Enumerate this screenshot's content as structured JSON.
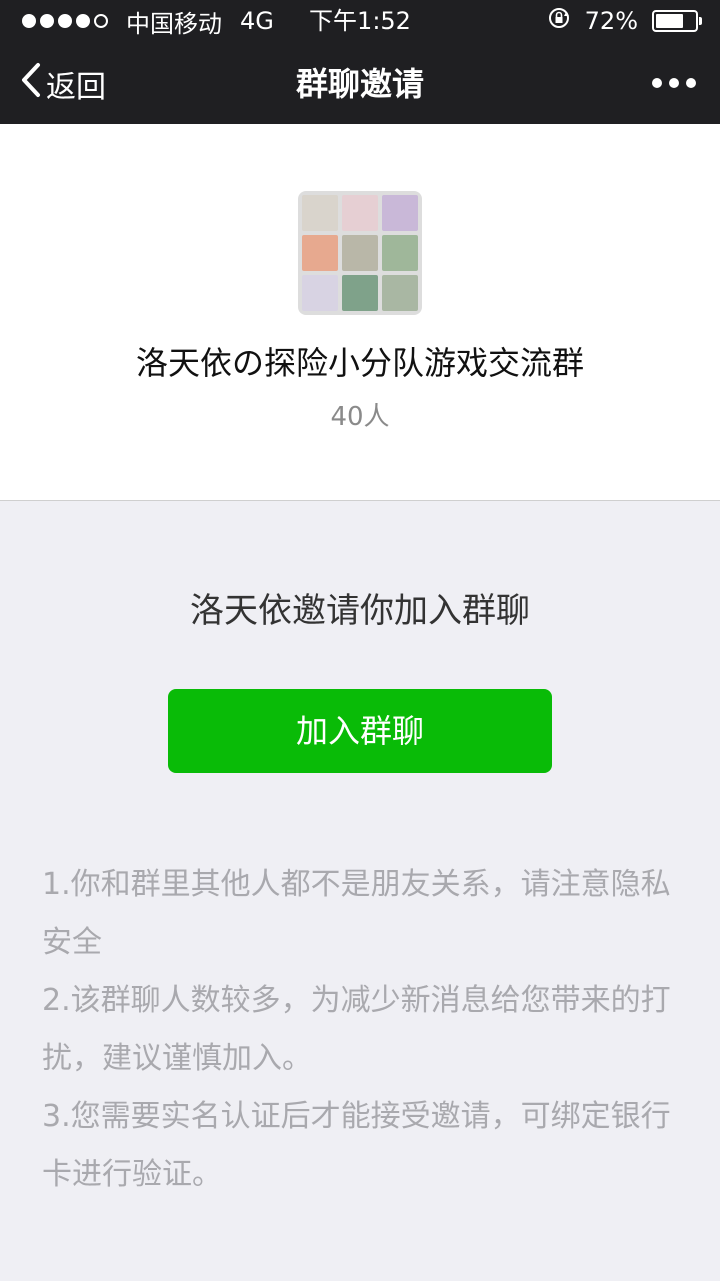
{
  "status_bar": {
    "carrier": "中国移动",
    "network": "4G",
    "time": "下午1:52",
    "battery_percent_text": "72%",
    "battery_level": 0.72,
    "signal_bars_filled": 4,
    "signal_bars_total": 5,
    "icons": [
      "signal-dots",
      "rotation-lock-icon",
      "battery-icon"
    ]
  },
  "navbar": {
    "back_label": "返回",
    "title": "群聊邀请",
    "back_icon": "chevron-left-icon",
    "more_icon": "more-dots-icon"
  },
  "group": {
    "name": "洛天依の探险小分队游戏交流群",
    "member_count": "40人",
    "avatar_colors": [
      "#d9d4cc",
      "#e6cfd3",
      "#c9b8d8",
      "#e7a98f",
      "#b9b7a8",
      "#9fb79a",
      "#d8d3e3",
      "#7fa28a",
      "#a9b7a3"
    ]
  },
  "invite": {
    "message": "洛天依邀请你加入群聊",
    "join_button_label": "加入群聊"
  },
  "notes": [
    "1.你和群里其他人都不是朋友关系，请注意隐私安全",
    "2.该群聊人数较多，为减少新消息给您带来的打扰，建议谨慎加入。",
    "3.您需要实名认证后才能接受邀请，可绑定银行卡进行验证。"
  ],
  "colors": {
    "bar_background": "#1f1f22",
    "page_background": "#efeff4",
    "accent_green": "#09bb07",
    "note_text": "#a9a9ae"
  }
}
